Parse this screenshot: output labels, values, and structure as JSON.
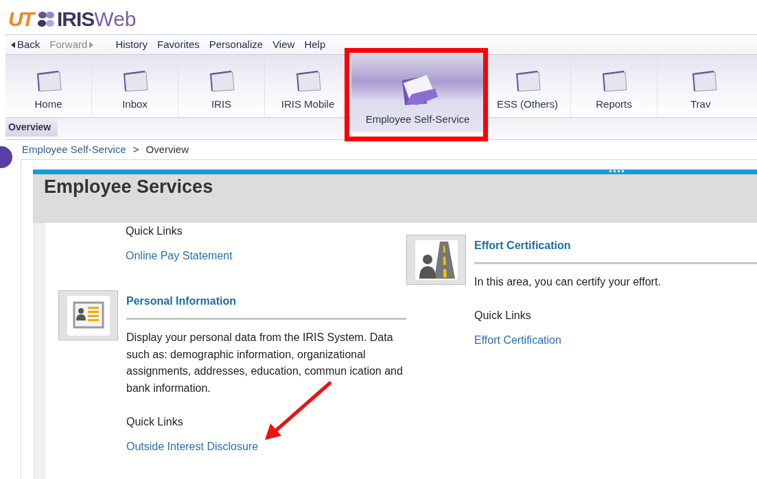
{
  "logo": {
    "mark": "UT",
    "name": "IRIS",
    "suffix": "Web"
  },
  "menu": [
    {
      "label": "Back",
      "kind": "back",
      "disabled": false
    },
    {
      "label": "Forward",
      "kind": "forward",
      "disabled": true
    },
    {
      "label": "History",
      "kind": "plain",
      "disabled": false
    },
    {
      "label": "Favorites",
      "kind": "plain",
      "disabled": false
    },
    {
      "label": "Personalize",
      "kind": "plain",
      "disabled": false
    },
    {
      "label": "View",
      "kind": "plain",
      "disabled": false
    },
    {
      "label": "Help",
      "kind": "plain",
      "disabled": false
    }
  ],
  "tabs": [
    {
      "label": "Home",
      "selected": false,
      "highlighted": false
    },
    {
      "label": "Inbox",
      "selected": false,
      "highlighted": false
    },
    {
      "label": "IRIS",
      "selected": false,
      "highlighted": false
    },
    {
      "label": "IRIS Mobile",
      "selected": false,
      "highlighted": false
    },
    {
      "label": "Employee Self-Service",
      "selected": true,
      "highlighted": true
    },
    {
      "label": "ESS (Others)",
      "selected": false,
      "highlighted": false
    },
    {
      "label": "Reports",
      "selected": false,
      "highlighted": false
    },
    {
      "label": "Trav",
      "selected": false,
      "highlighted": false
    }
  ],
  "subtabs": [
    {
      "label": "Overview",
      "selected": true
    }
  ],
  "breadcrumb": [
    "Employee Self-Service",
    ">",
    "Overview"
  ],
  "page_title": "Employee Services",
  "left_column": [
    {
      "kind": "links",
      "quick_links_label": "Quick Links",
      "links": [
        {
          "text": "Online Pay Statement",
          "annotated": false
        }
      ]
    },
    {
      "kind": "service",
      "title": "Personal Information",
      "description": "Display your personal data from the IRIS System. Data such as: demographic information, organizational assignments, addresses, education, commun ication and bank information.",
      "quick_links_label": "Quick Links",
      "links": [
        {
          "text": "Outside Interest Disclosure",
          "annotated": true
        }
      ]
    }
  ],
  "right_column": [
    {
      "kind": "service",
      "title": "Effort Certification",
      "description": "In this area, you can certify your effort.",
      "quick_links_label": "Quick Links",
      "links": [
        {
          "text": "Effort Certification",
          "annotated": false
        }
      ]
    }
  ]
}
